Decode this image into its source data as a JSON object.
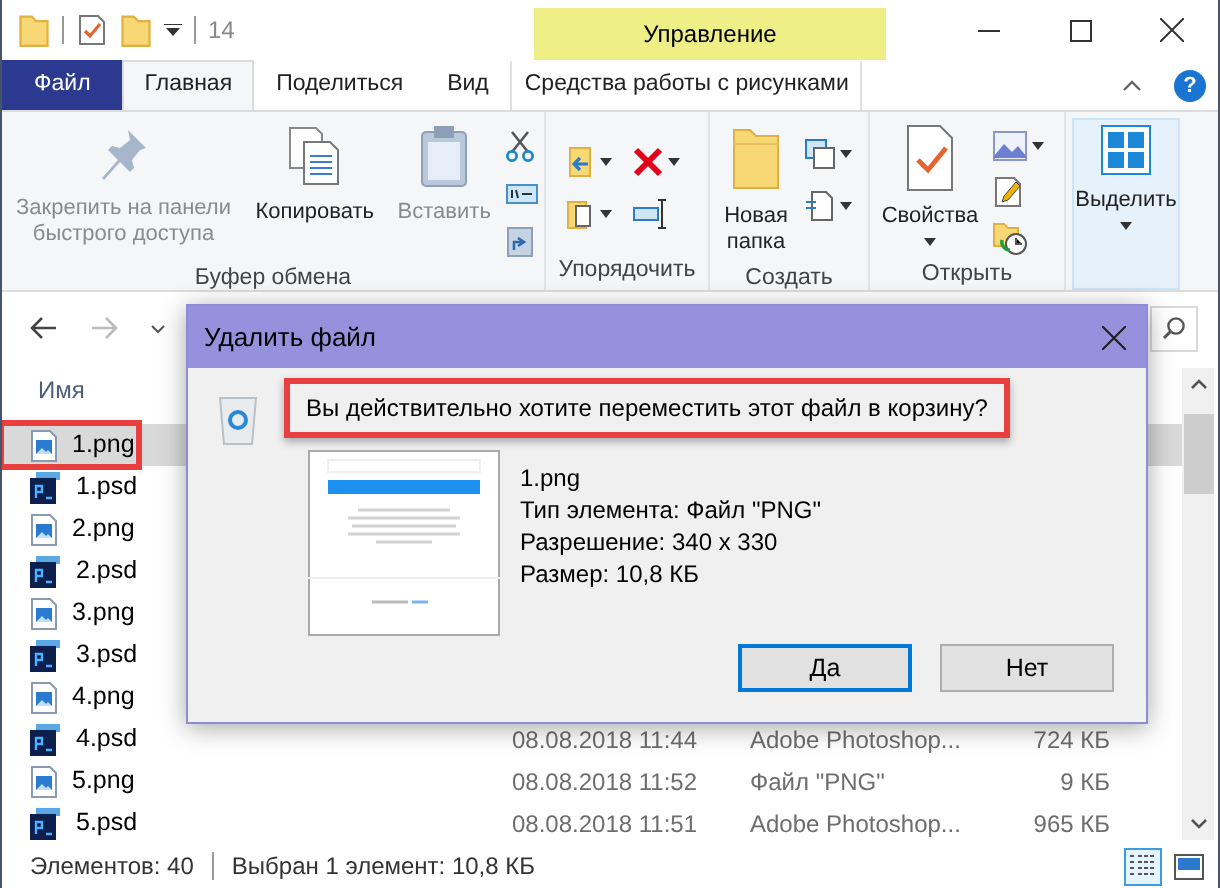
{
  "titlebar": {
    "title": "14",
    "context_label": "Управление"
  },
  "tabs": [
    {
      "label": "Файл",
      "kind": "file",
      "selected": false
    },
    {
      "label": "Главная",
      "kind": "tab",
      "selected": true
    },
    {
      "label": "Поделиться",
      "kind": "tab",
      "selected": false
    },
    {
      "label": "Вид",
      "kind": "tab",
      "selected": false
    },
    {
      "label": "Средства работы с рисунками",
      "kind": "context",
      "selected": false
    }
  ],
  "help": "?",
  "ribbon": [
    {
      "label": "Буфер обмена",
      "commands": [
        {
          "label": "Закрепить на панели быстрого доступа",
          "disabled": true,
          "highlighted": false
        },
        {
          "label": "Копировать",
          "disabled": false,
          "highlighted": false
        },
        {
          "label": "Вставить",
          "disabled": true,
          "highlighted": false
        }
      ]
    },
    {
      "label": "Упорядочить"
    },
    {
      "label": "Создать",
      "commands": [
        {
          "label": "Новая папка",
          "disabled": false,
          "highlighted": false
        }
      ]
    },
    {
      "label": "Открыть",
      "commands": [
        {
          "label": "Свойства",
          "disabled": false,
          "highlighted": false
        }
      ]
    },
    {
      "commands": [
        {
          "label": "Выделить",
          "disabled": false,
          "highlighted": true
        }
      ]
    }
  ],
  "files": {
    "columns": [
      {
        "label": "Имя"
      }
    ],
    "rows": [
      {
        "name": "1.png",
        "kind": "png",
        "selected": true,
        "highlighted": true
      },
      {
        "name": "1.psd",
        "kind": "psd",
        "selected": false,
        "highlighted": false
      },
      {
        "name": "2.png",
        "kind": "png",
        "selected": false,
        "highlighted": false
      },
      {
        "name": "2.psd",
        "kind": "psd",
        "selected": false,
        "highlighted": false
      },
      {
        "name": "3.png",
        "kind": "png",
        "selected": false,
        "highlighted": false
      },
      {
        "name": "3.psd",
        "kind": "psd",
        "selected": false,
        "highlighted": false
      },
      {
        "name": "4.png",
        "kind": "png",
        "selected": false,
        "highlighted": false
      },
      {
        "name": "4.psd",
        "kind": "psd",
        "selected": false,
        "highlighted": false,
        "date": "08.08.2018 11:44",
        "type": "Adobe Photoshop...",
        "size": "724 КБ"
      },
      {
        "name": "5.png",
        "kind": "png",
        "selected": false,
        "highlighted": false,
        "date": "08.08.2018 11:52",
        "type": "Файл \"PNG\"",
        "size": "9 КБ"
      },
      {
        "name": "5.psd",
        "kind": "psd",
        "selected": false,
        "highlighted": false,
        "date": "08.08.2018 11:51",
        "type": "Adobe Photoshop...",
        "size": "965 КБ"
      }
    ]
  },
  "status": {
    "items": "Элементов: 40",
    "selection": "Выбран 1 элемент: 10,8 КБ",
    "views": [
      {
        "selected": true
      },
      {
        "selected": false
      }
    ]
  },
  "dialog": {
    "title": "Удалить файл",
    "question": "Вы действительно хотите переместить этот файл в корзину?",
    "highlighted": true,
    "details": [
      "1.png",
      "Тип элемента: Файл \"PNG\"",
      "Разрешение: 340 x 330",
      "Размер: 10,8 КБ"
    ],
    "buttons": [
      {
        "label": "Да",
        "default": true
      },
      {
        "label": "Нет",
        "default": false
      }
    ]
  }
}
